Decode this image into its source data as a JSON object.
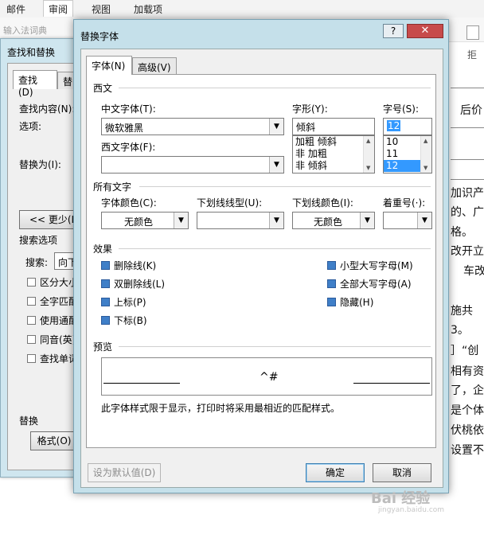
{
  "ribbon": {
    "tabs": [
      "邮件",
      "审阅",
      "视图",
      "加载项"
    ],
    "active_tab": "审阅",
    "ime_dict": "输入法词典",
    "side_label": "拒"
  },
  "doc_text": [
    "后价",
    "加识产",
    "的、广",
    "格。",
    "改开立",
    "车改",
    "施共",
    "3。",
    "］“创",
    "相有资",
    "了，企",
    "是个体",
    "伏桃依",
    "设置不"
  ],
  "find_replace": {
    "title": "查找和替换",
    "tab_find": "查找(D)",
    "tab_replace_fragment": "替",
    "find_label": "查找内容(N):",
    "options_label": "选项:",
    "replace_label": "替换为(I):",
    "less_button": "<< 更少(L)",
    "search_options": "搜索选项",
    "search_label": "搜索:",
    "search_value": "向下",
    "checkboxes": [
      "区分大小",
      "全字匹配",
      "使用通配",
      "同音(英)",
      "查找单词"
    ],
    "replace_section": "替换",
    "format_button": "格式(O) ▾"
  },
  "font_dialog": {
    "title": "替换字体",
    "help": "?",
    "close": "✕",
    "tabs": [
      "字体(N)",
      "高级(V)"
    ],
    "section_western": "西文",
    "chinese_font_label": "中文字体(T):",
    "chinese_font_value": "微软雅黑",
    "western_font_label": "西文字体(F):",
    "western_font_value": "",
    "style_label": "字形(Y):",
    "style_value": "倾斜",
    "style_list": [
      "加粗 倾斜",
      "非 加粗",
      "非 倾斜"
    ],
    "size_label": "字号(S):",
    "size_value": "12",
    "size_list": [
      "10",
      "11",
      "12"
    ],
    "size_selected_index": 2,
    "section_all_text": "所有文字",
    "font_color_label": "字体颜色(C):",
    "font_color_value": "无颜色",
    "underline_label": "下划线线型(U):",
    "underline_value": "",
    "underline_color_label": "下划线颜色(I):",
    "underline_color_value": "无颜色",
    "emphasis_label": "着重号(·):",
    "emphasis_value": "",
    "section_effects": "效果",
    "effects_left": [
      "删除线(K)",
      "双删除线(L)",
      "上标(P)",
      "下标(B)"
    ],
    "effects_right": [
      "小型大写字母(M)",
      "全部大写字母(A)",
      "隐藏(H)"
    ],
    "section_preview": "预览",
    "preview_text": "^#",
    "preview_note": "此字体样式限于显示，打印时将采用最相近的匹配样式。",
    "btn_default": "设为默认值(D)",
    "btn_ok": "确定",
    "btn_cancel": "取消"
  },
  "watermark": {
    "text": "Bai 经验",
    "sub": "jingyan.baidu.com"
  }
}
